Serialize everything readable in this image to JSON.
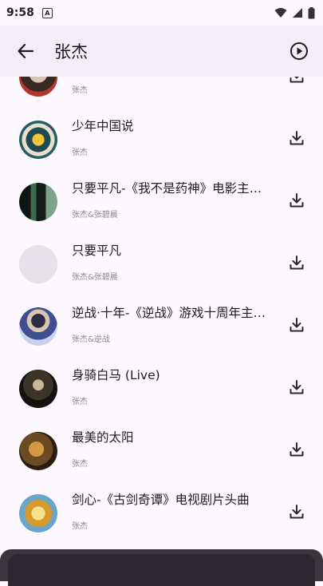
{
  "status_bar": {
    "time": "9:58",
    "notification_glyph": "A"
  },
  "app_bar": {
    "title": "张杰"
  },
  "songs": [
    {
      "title": "",
      "artist": "张杰"
    },
    {
      "title": "少年中国说",
      "artist": "张杰"
    },
    {
      "title": "只要平凡-《我不是药神》电影主题曲",
      "artist": "张杰&张碧晨"
    },
    {
      "title": "只要平凡",
      "artist": "张杰&张碧晨"
    },
    {
      "title": "逆战·十年-《逆战》游戏十周年主题曲",
      "artist": "张杰&逆战"
    },
    {
      "title": "身骑白马 (Live)",
      "artist": "张杰"
    },
    {
      "title": "最美的太阳",
      "artist": "张杰"
    },
    {
      "title": "剑心-《古剑奇谭》电视剧片头曲",
      "artist": "张杰"
    },
    {
      "title": "",
      "artist": ""
    }
  ],
  "icons": {
    "back": "arrow-back-icon",
    "play": "play-circle-icon",
    "download": "download-icon"
  },
  "colors": {
    "background": "#fcf8fd",
    "app_bar": "#f3edf7",
    "text_primary": "#1d1b20",
    "text_secondary": "#8a8a8a",
    "sheet": "#39363d"
  }
}
